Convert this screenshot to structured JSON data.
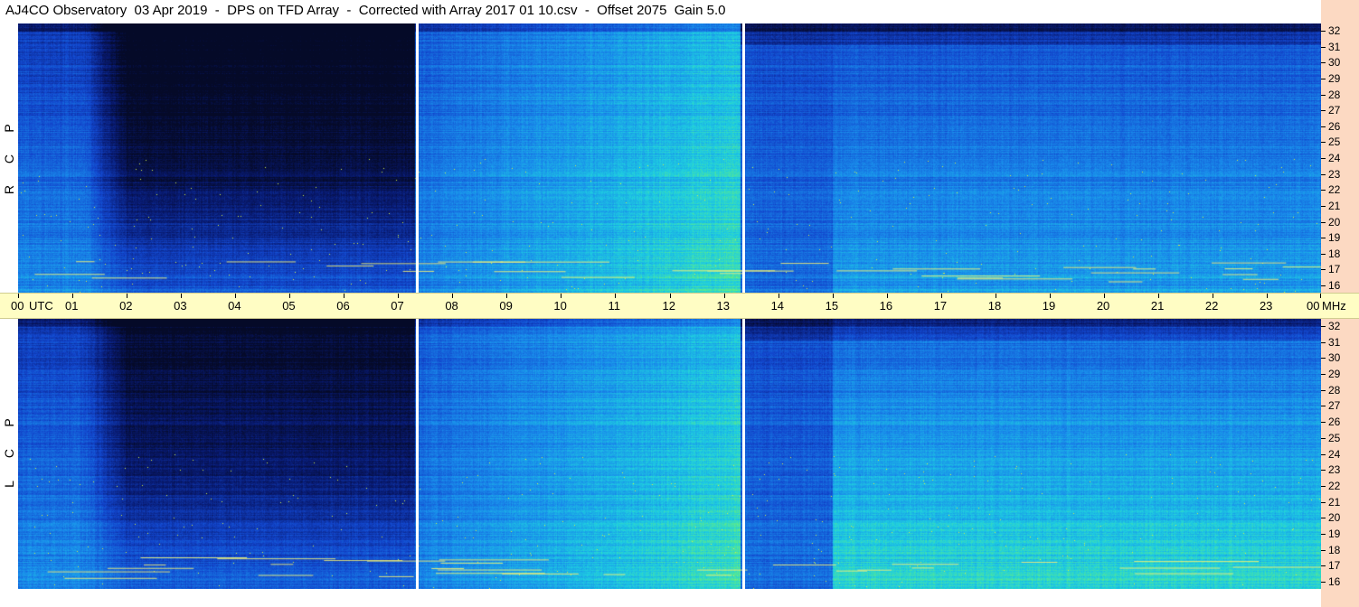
{
  "title": "AJ4CO Observatory  03 Apr 2019  -  DPS on TFD Array  -  Corrected with Array 2017 01 10.csv  -  Offset 2075  Gain 5.0",
  "polarization_labels": {
    "rcp": [
      "R",
      "C",
      "P"
    ],
    "lcp": [
      "L",
      "C",
      "P"
    ]
  },
  "colors": {
    "background_dark": "#0b2f9a",
    "axis_yellow": "#fffdc4",
    "axis_peach": "#fcd9c2"
  },
  "chart_data": {
    "type": "heatmap",
    "description_colormap": "blue-cyan-green spectrogram",
    "x_axis": {
      "unit_label": "UTC",
      "ticks": [
        "00",
        "01",
        "02",
        "03",
        "04",
        "05",
        "06",
        "07",
        "08",
        "09",
        "10",
        "11",
        "12",
        "13",
        "14",
        "15",
        "16",
        "17",
        "18",
        "19",
        "20",
        "21",
        "22",
        "23",
        "00"
      ],
      "range_hours": [
        0,
        24
      ]
    },
    "y_axis": {
      "unit_label": "MHz",
      "ticks": [
        16,
        17,
        18,
        19,
        20,
        21,
        22,
        23,
        24,
        25,
        26,
        27,
        28,
        29,
        30,
        31,
        32
      ],
      "range_mhz": [
        16,
        32
      ]
    },
    "panels": [
      "RCP",
      "LCP"
    ],
    "data_gaps_hours": [
      7.35,
      13.35
    ]
  }
}
